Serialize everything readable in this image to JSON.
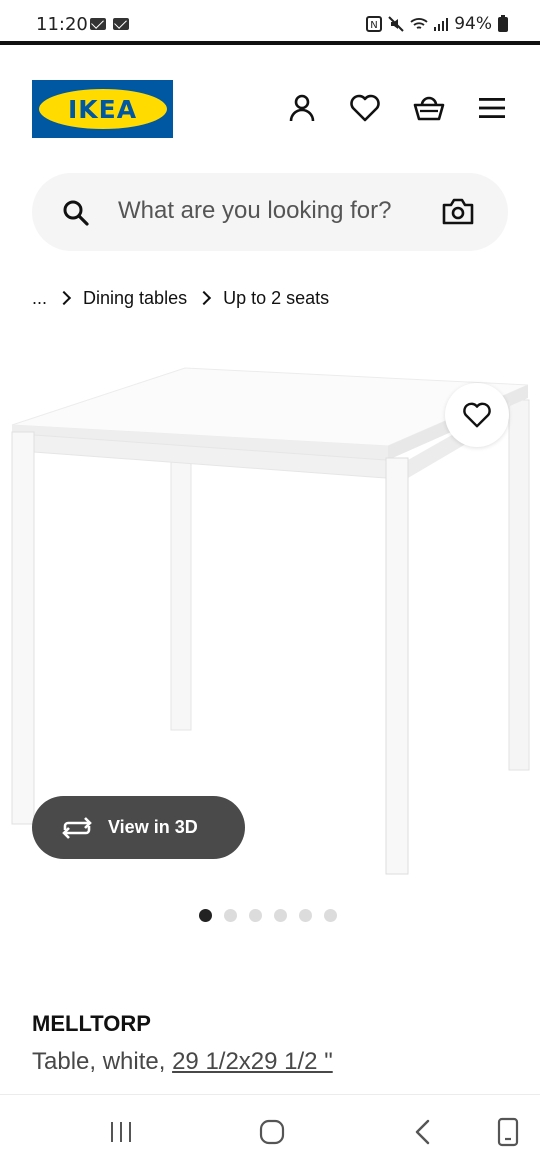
{
  "status_bar": {
    "time": "11:20",
    "battery": "94%",
    "icons": [
      "mail-icon",
      "mail-icon",
      "nfc-icon",
      "mute-icon",
      "wifi-icon",
      "signal-icon",
      "battery-icon"
    ]
  },
  "header": {
    "logo_text": "IKEA",
    "icons": [
      "account-icon",
      "heart-icon",
      "basket-icon",
      "menu-icon"
    ]
  },
  "search": {
    "placeholder": "What are you looking for?",
    "icons": [
      "search-icon",
      "camera-icon"
    ]
  },
  "breadcrumb": {
    "items": [
      "...",
      "Dining tables",
      "Up to 2 seats"
    ]
  },
  "gallery": {
    "view3d_label": "View in 3D",
    "dot_count": 6,
    "active_dot": 1
  },
  "product": {
    "name": "MELLTORP",
    "description": "Table, white,",
    "size": "29 1/2x29 1/2 \""
  },
  "nav_bar": {
    "icons": [
      "recents-icon",
      "home-icon",
      "back-icon",
      "screenshot-icon"
    ]
  },
  "colors": {
    "ikea_blue": "#0058a3",
    "ikea_yellow": "#ffdb00",
    "view3d_bg": "#4a4a4a",
    "search_bg": "#f5f5f5"
  }
}
